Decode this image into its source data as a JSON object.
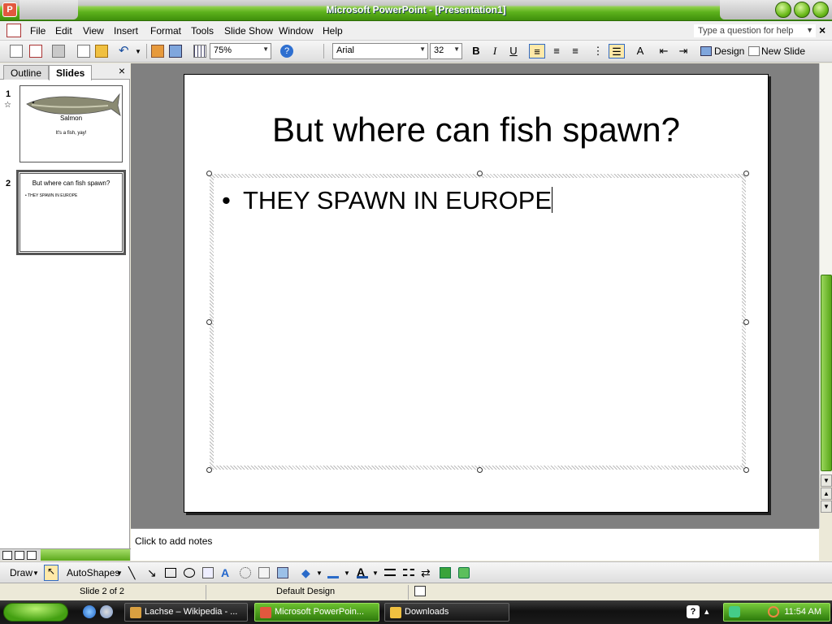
{
  "window": {
    "title": "Microsoft PowerPoint - [Presentation1]"
  },
  "menu": {
    "items": [
      "File",
      "Edit",
      "View",
      "Insert",
      "Format",
      "Tools",
      "Slide Show",
      "Window",
      "Help"
    ],
    "help_placeholder": "Type a question for help"
  },
  "toolbar": {
    "zoom": "75%",
    "font": "Arial",
    "font_size": "32",
    "bold": "B",
    "italic": "I",
    "underline": "U",
    "design_label": "Design",
    "new_slide_label": "New Slide"
  },
  "pane": {
    "tabs": [
      "Outline",
      "Slides"
    ],
    "active_tab": "Slides",
    "close": "×"
  },
  "thumbnails": [
    {
      "number": "1",
      "title": "Salmon",
      "subtitle": "It's a fish, yay!"
    },
    {
      "number": "2",
      "title": "But where can fish spawn?",
      "bullet": "• THEY SPAWN IN EUROPE"
    }
  ],
  "slide": {
    "title": "But where can fish spawn?",
    "bullets": [
      "THEY SPAWN IN EUROPE"
    ]
  },
  "notes": {
    "placeholder": "Click to add notes"
  },
  "draw_toolbar": {
    "draw_label": "Draw",
    "autoshapes_label": "AutoShapes"
  },
  "status": {
    "slide_position": "Slide 2 of 2",
    "design": "Default Design"
  },
  "taskbar": {
    "tasks": [
      {
        "label": "Lachse – Wikipedia - ...",
        "active": false
      },
      {
        "label": "Microsoft PowerPoin...",
        "active": true
      },
      {
        "label": "Downloads",
        "active": false
      }
    ],
    "clock": "11:54 AM"
  },
  "colors": {
    "xp_green": "#5cb11c",
    "workspace_gray": "#808080"
  }
}
